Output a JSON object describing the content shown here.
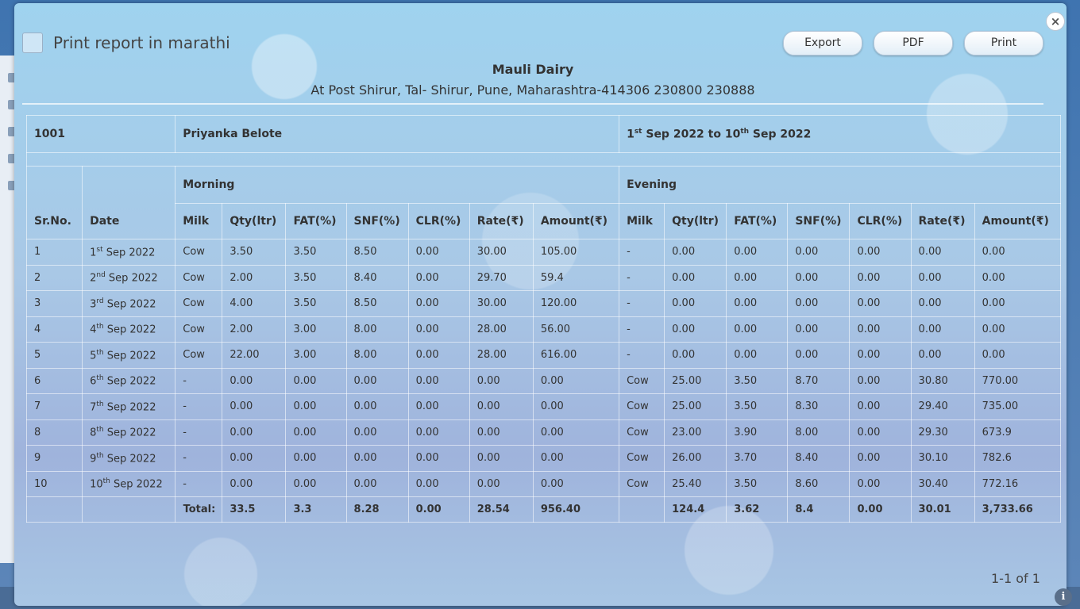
{
  "modal": {
    "close_glyph": "×",
    "marathi_label": "Print report in marathi",
    "buttons": {
      "export": "Export",
      "pdf": "PDF",
      "print": "Print"
    },
    "title": "Mauli Dairy",
    "address": "At Post Shirur, Tal- Shirur, Pune, Maharashtra-414306 230800 230888",
    "pager": "1-1 of 1",
    "info_glyph": "i"
  },
  "report": {
    "member_code": "1001",
    "member_name": "Priyanka Belote",
    "period": {
      "from_day": "1",
      "from_suffix": "st",
      "from_rest": " Sep 2022 to 10",
      "to_suffix": "th",
      "to_rest": " Sep 2022"
    },
    "groups": {
      "morning": "Morning",
      "evening": "Evening"
    },
    "columns": {
      "srno": "Sr.No.",
      "date": "Date",
      "milk": "Milk",
      "qty": "Qty(ltr)",
      "fat": "FAT(%)",
      "snf": "SNF(%)",
      "clr": "CLR(%)",
      "rate": "Rate(₹)",
      "amount": "Amount(₹)"
    },
    "rows": [
      {
        "sr": "1",
        "day": "1",
        "suf": "st",
        "mon": " Sep 2022",
        "m": [
          "Cow",
          "3.50",
          "3.50",
          "8.50",
          "0.00",
          "30.00",
          "105.00"
        ],
        "e": [
          "-",
          "0.00",
          "0.00",
          "0.00",
          "0.00",
          "0.00",
          "0.00"
        ]
      },
      {
        "sr": "2",
        "day": "2",
        "suf": "nd",
        "mon": " Sep 2022",
        "m": [
          "Cow",
          "2.00",
          "3.50",
          "8.40",
          "0.00",
          "29.70",
          "59.4"
        ],
        "e": [
          "-",
          "0.00",
          "0.00",
          "0.00",
          "0.00",
          "0.00",
          "0.00"
        ]
      },
      {
        "sr": "3",
        "day": "3",
        "suf": "rd",
        "mon": " Sep 2022",
        "m": [
          "Cow",
          "4.00",
          "3.50",
          "8.50",
          "0.00",
          "30.00",
          "120.00"
        ],
        "e": [
          "-",
          "0.00",
          "0.00",
          "0.00",
          "0.00",
          "0.00",
          "0.00"
        ]
      },
      {
        "sr": "4",
        "day": "4",
        "suf": "th",
        "mon": " Sep 2022",
        "m": [
          "Cow",
          "2.00",
          "3.00",
          "8.00",
          "0.00",
          "28.00",
          "56.00"
        ],
        "e": [
          "-",
          "0.00",
          "0.00",
          "0.00",
          "0.00",
          "0.00",
          "0.00"
        ]
      },
      {
        "sr": "5",
        "day": "5",
        "suf": "th",
        "mon": " Sep 2022",
        "m": [
          "Cow",
          "22.00",
          "3.00",
          "8.00",
          "0.00",
          "28.00",
          "616.00"
        ],
        "e": [
          "-",
          "0.00",
          "0.00",
          "0.00",
          "0.00",
          "0.00",
          "0.00"
        ]
      },
      {
        "sr": "6",
        "day": "6",
        "suf": "th",
        "mon": " Sep 2022",
        "m": [
          "-",
          "0.00",
          "0.00",
          "0.00",
          "0.00",
          "0.00",
          "0.00"
        ],
        "e": [
          "Cow",
          "25.00",
          "3.50",
          "8.70",
          "0.00",
          "30.80",
          "770.00"
        ]
      },
      {
        "sr": "7",
        "day": "7",
        "suf": "th",
        "mon": " Sep 2022",
        "m": [
          "-",
          "0.00",
          "0.00",
          "0.00",
          "0.00",
          "0.00",
          "0.00"
        ],
        "e": [
          "Cow",
          "25.00",
          "3.50",
          "8.30",
          "0.00",
          "29.40",
          "735.00"
        ]
      },
      {
        "sr": "8",
        "day": "8",
        "suf": "th",
        "mon": " Sep 2022",
        "m": [
          "-",
          "0.00",
          "0.00",
          "0.00",
          "0.00",
          "0.00",
          "0.00"
        ],
        "e": [
          "Cow",
          "23.00",
          "3.90",
          "8.00",
          "0.00",
          "29.30",
          "673.9"
        ]
      },
      {
        "sr": "9",
        "day": "9",
        "suf": "th",
        "mon": " Sep 2022",
        "m": [
          "-",
          "0.00",
          "0.00",
          "0.00",
          "0.00",
          "0.00",
          "0.00"
        ],
        "e": [
          "Cow",
          "26.00",
          "3.70",
          "8.40",
          "0.00",
          "30.10",
          "782.6"
        ]
      },
      {
        "sr": "10",
        "day": "10",
        "suf": "th",
        "mon": " Sep 2022",
        "m": [
          "-",
          "0.00",
          "0.00",
          "0.00",
          "0.00",
          "0.00",
          "0.00"
        ],
        "e": [
          "Cow",
          "25.40",
          "3.50",
          "8.60",
          "0.00",
          "30.40",
          "772.16"
        ]
      }
    ],
    "totals": {
      "label": "Total:",
      "m": [
        "33.5",
        "3.3",
        "8.28",
        "0.00",
        "28.54",
        "956.40"
      ],
      "e": [
        "124.4",
        "3.62",
        "8.4",
        "0.00",
        "30.01",
        "3,733.66"
      ]
    }
  }
}
